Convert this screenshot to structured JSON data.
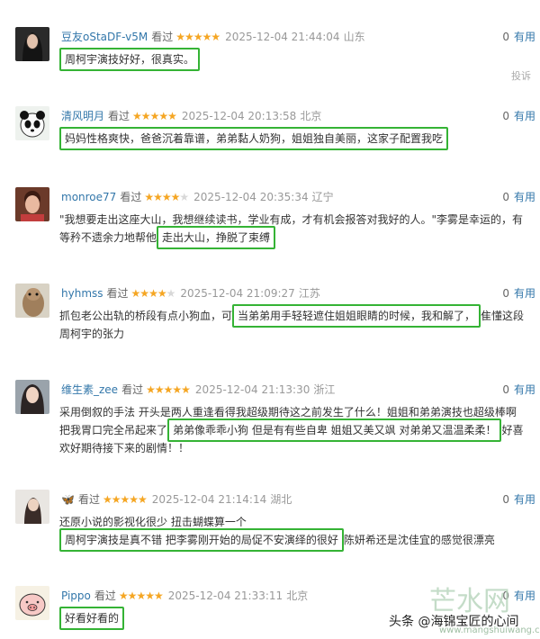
{
  "labels": {
    "useful": "有用",
    "report": "投诉"
  },
  "colors": {
    "link": "#3377aa",
    "star": "#f5a623",
    "highlight_box": "#35b335"
  },
  "reviews": [
    {
      "user": "豆友oStaDF-v5M",
      "status": "看过",
      "rating": 5,
      "time": "2025-12-04 21:44:04",
      "location": "山东",
      "votes": "0",
      "avatar": "dark-hair-portrait",
      "comment_before": "",
      "comment_highlight": "周柯宇演技好好，很真实。",
      "comment_after": ""
    },
    {
      "user": "清风明月",
      "status": "看过",
      "rating": 5,
      "time": "2025-12-04 20:13:58",
      "location": "北京",
      "votes": "0",
      "avatar": "panda",
      "comment_before": "",
      "comment_highlight": "妈妈性格爽快，爸爸沉着靠谱，弟弟黏人奶狗，姐姐独自美丽，这家子配置我吃",
      "comment_after": ""
    },
    {
      "user": "monroe77",
      "status": "看过",
      "rating": 4,
      "time": "2025-12-04 20:35:34",
      "location": "辽宁",
      "votes": "0",
      "avatar": "woman-portrait",
      "comment_before": "\"我想要走出这座大山，我想继续读书，学业有成，才有机会报答对我好的人。\"李雾是幸运的，有等矜不遗余力地帮他",
      "comment_highlight": "走出大山，挣脱了束缚",
      "comment_after": ""
    },
    {
      "user": "hyhmss",
      "status": "看过",
      "rating": 4,
      "time": "2025-12-04 21:09:27",
      "location": "江苏",
      "votes": "0",
      "avatar": "alpaca",
      "comment_before": "抓包老公出轨的桥段有点小狗血，可",
      "comment_highlight": "当弟弟用手轻轻遮住姐姐眼睛的时候，我和解了，",
      "comment_after": "隹懂这段周柯宇的张力"
    },
    {
      "user": "维生素_zee",
      "status": "看过",
      "rating": 5,
      "time": "2025-12-04 21:13:30",
      "location": "浙江",
      "votes": "0",
      "avatar": "girl-portrait",
      "comment_before": "采用倒叙的手法 开头是两人重逢看得我超级期待这之前发生了什么！姐姐和弟弟演技也超级棒啊 把我胃口完全吊起来了",
      "comment_highlight": "弟弟像乖乖小狗 但是有有些自卑 姐姐又美又飒 对弟弟又温温柔柔！",
      "comment_after": "好喜欢好期待接下来的剧情！！"
    },
    {
      "user": "🦋",
      "status": "看过",
      "rating": 5,
      "time": "2025-12-04 21:14:14",
      "location": "湖北",
      "votes": "0",
      "avatar": "woman-sitting",
      "comment_before": "还原小说的影视化很少 扭击蝴蝶算一个",
      "comment_highlight": "周柯宇演技是真不错 把李雾刚开始的局促不安演绎的很好",
      "comment_after": "陈妍希还是沈佳宜的感觉很漂亮"
    },
    {
      "user": "Pippo",
      "status": "看过",
      "rating": 5,
      "time": "2025-12-04 21:33:11",
      "location": "北京",
      "votes": "0",
      "avatar": "pig-cartoon",
      "comment_before": "",
      "comment_highlight": "好看好看的",
      "comment_after": ""
    }
  ],
  "watermark": {
    "brand": "芒水网",
    "author": "头条 @海锦宝匠的心间",
    "sub": "www.mangshuiwang.com"
  }
}
